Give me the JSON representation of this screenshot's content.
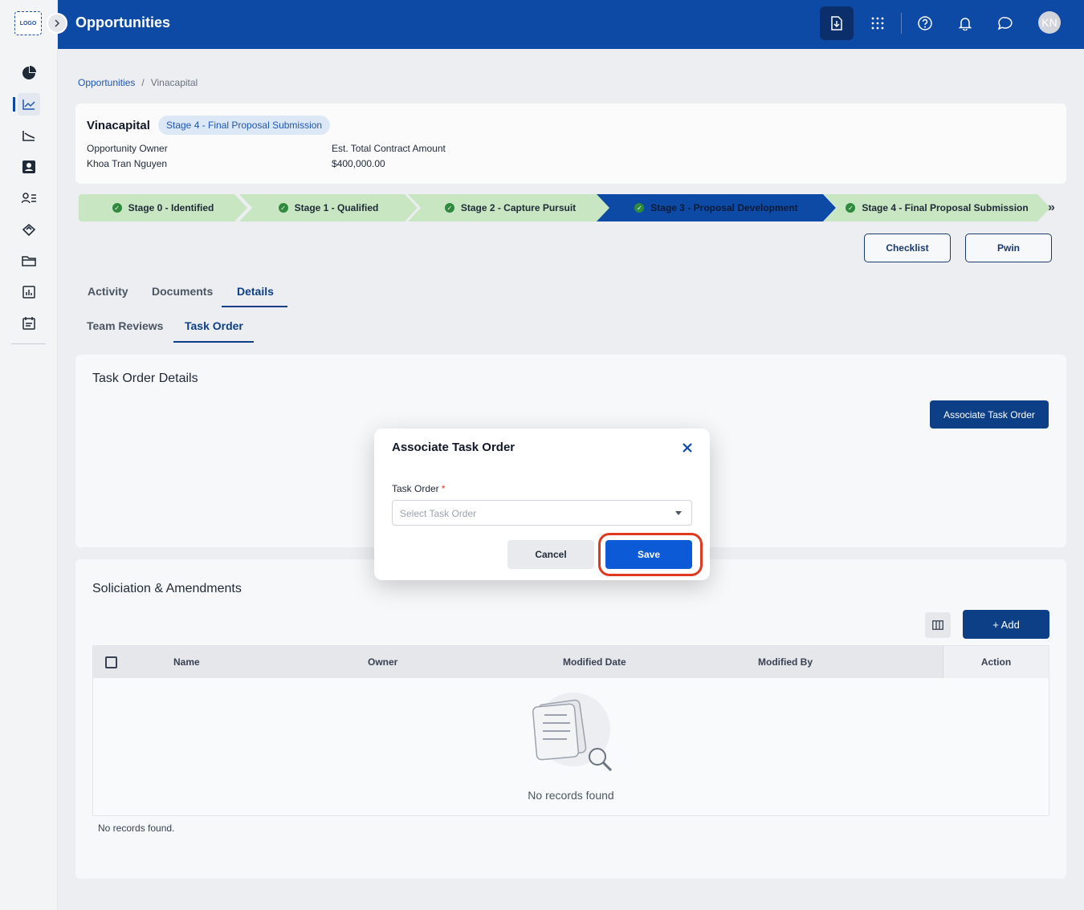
{
  "app": {
    "logo_text": "LOGO",
    "page_title": "Opportunities",
    "avatar_initials": "KN"
  },
  "breadcrumb": {
    "root": "Opportunities",
    "separator": "/",
    "current": "Vinacapital"
  },
  "opportunity": {
    "name": "Vinacapital",
    "stage_badge": "Stage 4 - Final Proposal Submission",
    "owner_label": "Opportunity Owner",
    "owner_value": "Khoa Tran Nguyen",
    "amount_label": "Est. Total Contract Amount",
    "amount_value": "$400,000.00"
  },
  "stages": [
    {
      "label": "Stage 0 - Identified",
      "status": "done"
    },
    {
      "label": "Stage 1 - Qualified",
      "status": "done"
    },
    {
      "label": "Stage 2 - Capture Pursuit",
      "status": "done"
    },
    {
      "label": "Stage 3 - Proposal Development",
      "status": "current"
    },
    {
      "label": "Stage 4 - Final Proposal Submission",
      "status": "done"
    }
  ],
  "stage_more": "»",
  "actions": {
    "checklist": "Checklist",
    "pwin": "Pwin"
  },
  "tabs": {
    "activity": "Activity",
    "documents": "Documents",
    "details": "Details"
  },
  "subtabs": {
    "team_reviews": "Team Reviews",
    "task_order": "Task Order"
  },
  "task_order_card": {
    "title": "Task Order Details",
    "associate_button": "Associate Task Order"
  },
  "solicitation_card": {
    "title": "Soliciation & Amendments",
    "add_button": "+ Add",
    "columns": [
      "Name",
      "Owner",
      "Modified Date",
      "Modified By",
      "Action"
    ],
    "empty_message": "No records found",
    "footer_text": "No records found."
  },
  "modal": {
    "title": "Associate Task Order",
    "field_label": "Task Order",
    "required_mark": "*",
    "placeholder": "Select Task Order",
    "cancel": "Cancel",
    "save": "Save"
  },
  "colors": {
    "header": "#0d4aa6",
    "primary": "#0d3f86",
    "save": "#0d5ad6",
    "highlight": "#e0391f",
    "stage_done": "#c7e6c1"
  }
}
